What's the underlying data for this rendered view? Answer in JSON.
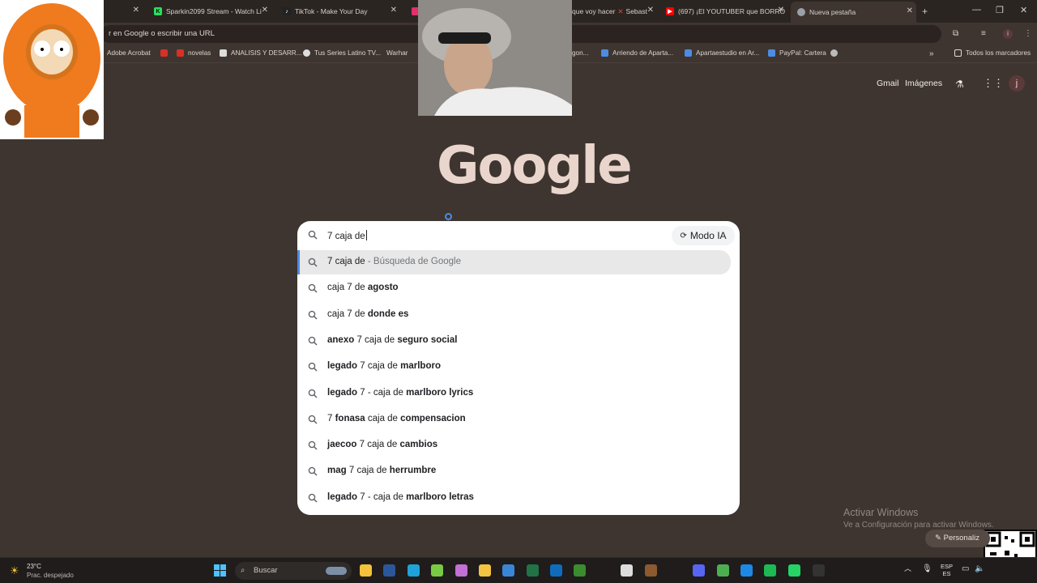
{
  "browser": {
    "tabs": [
      {
        "label": "Sparkin2099 Stream - Watch Li",
        "icon_color": "#29e05a"
      },
      {
        "label": "TikTok - Make Your Day",
        "icon_color": "#222222"
      },
      {
        "label": "que voy hacer",
        "icon_color": "#e1306c"
      },
      {
        "label": "Sebast",
        "icon_color": "#e04040"
      },
      {
        "label": "(697) ¡El YOUTUBER que BORRÓ",
        "icon_color": "#ff0000"
      },
      {
        "label": "Nueva pestaña",
        "icon_color": "#9aa0a6"
      }
    ],
    "new_tab_label": "+",
    "address_placeholder": "r en Google o escribir una URL",
    "bookmarks": [
      {
        "label": "Adobe Acrobat",
        "icon_color": "#d93025"
      },
      {
        "label": "novelas",
        "icon_color": "#d93025"
      },
      {
        "label": "ANALISIS Y DESARR...",
        "icon_color": "#dddddd"
      },
      {
        "label": "Tus Series Latino TV...",
        "icon_color": "#dddddd"
      },
      {
        "label": "Warhar",
        "icon_color": "#555555"
      },
      {
        "label": "gon...",
        "icon_color": "#555555"
      },
      {
        "label": "Arriendo de Aparta...",
        "icon_color": "#4c8ce4"
      },
      {
        "label": "Apartaestudio en Ar...",
        "icon_color": "#4c8ce4"
      },
      {
        "label": "PayPal: Cartera",
        "icon_color": "#4c8ce4"
      }
    ],
    "bookmarks_more": "»",
    "all_bookmarks": "Todos los marcadores"
  },
  "google": {
    "gmail": "Gmail",
    "images": "Imágenes",
    "avatar_letter": "j",
    "logo": "Google",
    "query": "7 caja de",
    "modo_ia": "Modo IA",
    "suggestions": [
      {
        "parts": [
          {
            "t": "7 caja de",
            "b": false
          },
          {
            "t": " - Búsqueda de Google",
            "tail": true
          }
        ]
      },
      {
        "parts": [
          {
            "t": "caja 7 de ",
            "b": false
          },
          {
            "t": "agosto",
            "b": true
          }
        ]
      },
      {
        "parts": [
          {
            "t": "caja 7 de ",
            "b": false
          },
          {
            "t": "donde es",
            "b": true
          }
        ]
      },
      {
        "parts": [
          {
            "t": "anexo",
            "b": true
          },
          {
            "t": " 7 caja de ",
            "b": false
          },
          {
            "t": "seguro social",
            "b": true
          }
        ]
      },
      {
        "parts": [
          {
            "t": "legado",
            "b": true
          },
          {
            "t": " 7 caja de ",
            "b": false
          },
          {
            "t": "marlboro",
            "b": true
          }
        ]
      },
      {
        "parts": [
          {
            "t": "legado",
            "b": true
          },
          {
            "t": " 7 - caja de ",
            "b": false
          },
          {
            "t": "marlboro lyrics",
            "b": true
          }
        ]
      },
      {
        "parts": [
          {
            "t": "7 ",
            "b": false
          },
          {
            "t": "fonasa",
            "b": true
          },
          {
            "t": " caja de ",
            "b": false
          },
          {
            "t": "compensacion",
            "b": true
          }
        ]
      },
      {
        "parts": [
          {
            "t": "jaecoo",
            "b": true
          },
          {
            "t": " 7 caja de ",
            "b": false
          },
          {
            "t": "cambios",
            "b": true
          }
        ]
      },
      {
        "parts": [
          {
            "t": "mag",
            "b": true
          },
          {
            "t": " 7 caja de ",
            "b": false
          },
          {
            "t": "herrumbre",
            "b": true
          }
        ]
      },
      {
        "parts": [
          {
            "t": "legado",
            "b": true
          },
          {
            "t": " 7 - caja de ",
            "b": false
          },
          {
            "t": "marlboro letras",
            "b": true
          }
        ]
      }
    ]
  },
  "windows": {
    "activate_title": "Activar Windows",
    "activate_sub": "Ve a Configuración para activar Windows.",
    "personalize": "Personaliz",
    "weather_temp": "23°C",
    "weather_desc": "Prac. despejado",
    "taskbar_search": "Buscar",
    "lang_top": "ESP",
    "lang_bottom": "ES",
    "taskbar_apps": [
      {
        "name": "file-explorer",
        "color": "#f3c13a"
      },
      {
        "name": "word",
        "color": "#2b579a"
      },
      {
        "name": "edge",
        "color": "#1fa2d8"
      },
      {
        "name": "app-green",
        "color": "#7ac943"
      },
      {
        "name": "copilot",
        "color": "#c270d6"
      },
      {
        "name": "folder",
        "color": "#f5c342"
      },
      {
        "name": "store",
        "color": "#3a86d6"
      },
      {
        "name": "excel",
        "color": "#217346"
      },
      {
        "name": "outlook",
        "color": "#0f6cbd"
      },
      {
        "name": "minecraft",
        "color": "#3b8c2e"
      },
      {
        "name": "chrome",
        "color": "#dddddd"
      },
      {
        "name": "minecraft-dungeons",
        "color": "#8c5a2e"
      },
      {
        "name": "discord",
        "color": "#5865f2"
      },
      {
        "name": "chrome-profile",
        "color": "#4caf50"
      },
      {
        "name": "app-blue",
        "color": "#1e88e5"
      },
      {
        "name": "spotify",
        "color": "#1db954"
      },
      {
        "name": "whatsapp",
        "color": "#25d366"
      },
      {
        "name": "app-dark",
        "color": "#333333"
      }
    ]
  }
}
